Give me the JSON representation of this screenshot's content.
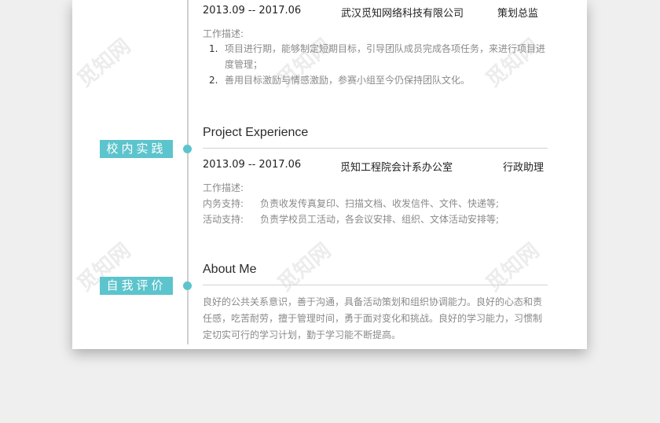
{
  "work": {
    "date": "2013.09 -- 2017.06",
    "company": "武汉觅知网络科技有限公司",
    "role": "策划总监",
    "desc_label": "工作描述:",
    "items": [
      {
        "num": "1.",
        "text": "项目进行期，能够制定短期目标，引导团队成员完成各项任务，来进行项目进度管理；"
      },
      {
        "num": "2.",
        "text": "善用目标激励与情感激励，参赛小组至今仍保持团队文化。"
      }
    ]
  },
  "project": {
    "tag": "校内实践",
    "heading": "Project Experience",
    "date": "2013.09 -- 2017.06",
    "org": "觅知工程院会计系办公室",
    "role": "行政助理",
    "desc_label": "工作描述:",
    "lines": [
      {
        "label": "内务支持:",
        "text": "负责收发传真复印、扫描文档、收发信件、文件、快递等;"
      },
      {
        "label": "活动支持:",
        "text": "负责学校员工活动，各会议安排、组织、文体活动安排等;"
      }
    ]
  },
  "about": {
    "tag": "自我评价",
    "heading": "About Me",
    "text": "良好的公共关系意识，善于沟通，具备活动策划和组织协调能力。良好的心态和责任感，吃苦耐劳，擅于管理时间，勇于面对变化和挑战。良好的学习能力，习惯制定切实可行的学习计划，勤于学习能不断提高。"
  },
  "watermark": "觅知网",
  "colors": {
    "accent": "#5cc4cc",
    "background": "#efefef",
    "paper": "#ffffff"
  }
}
